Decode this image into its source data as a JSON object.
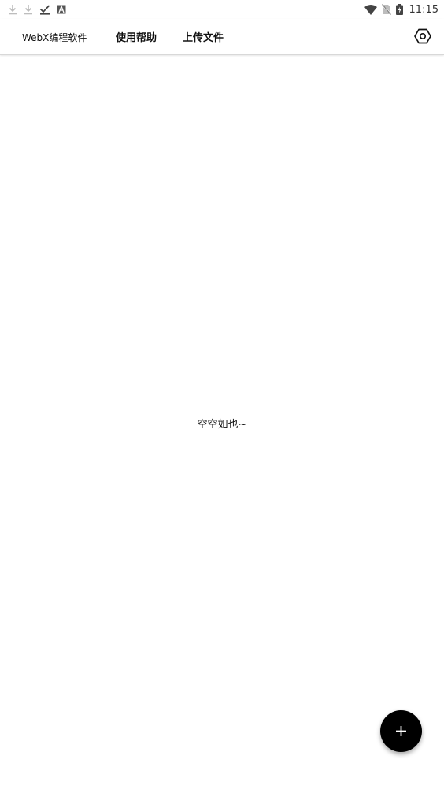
{
  "status_bar": {
    "time": "11:15",
    "left_icons": [
      "download-icon",
      "download-icon",
      "check-icon",
      "text-a-icon"
    ],
    "right_icons": [
      "wifi-icon",
      "no-sim-icon",
      "battery-charging-icon"
    ]
  },
  "app_bar": {
    "title": "WebX编程软件",
    "tabs": [
      {
        "label": "使用帮助"
      },
      {
        "label": "上传文件"
      }
    ],
    "settings_icon": "settings-icon"
  },
  "main": {
    "empty_message": "空空如也~"
  },
  "fab": {
    "icon": "plus-icon",
    "color": "#000000"
  }
}
